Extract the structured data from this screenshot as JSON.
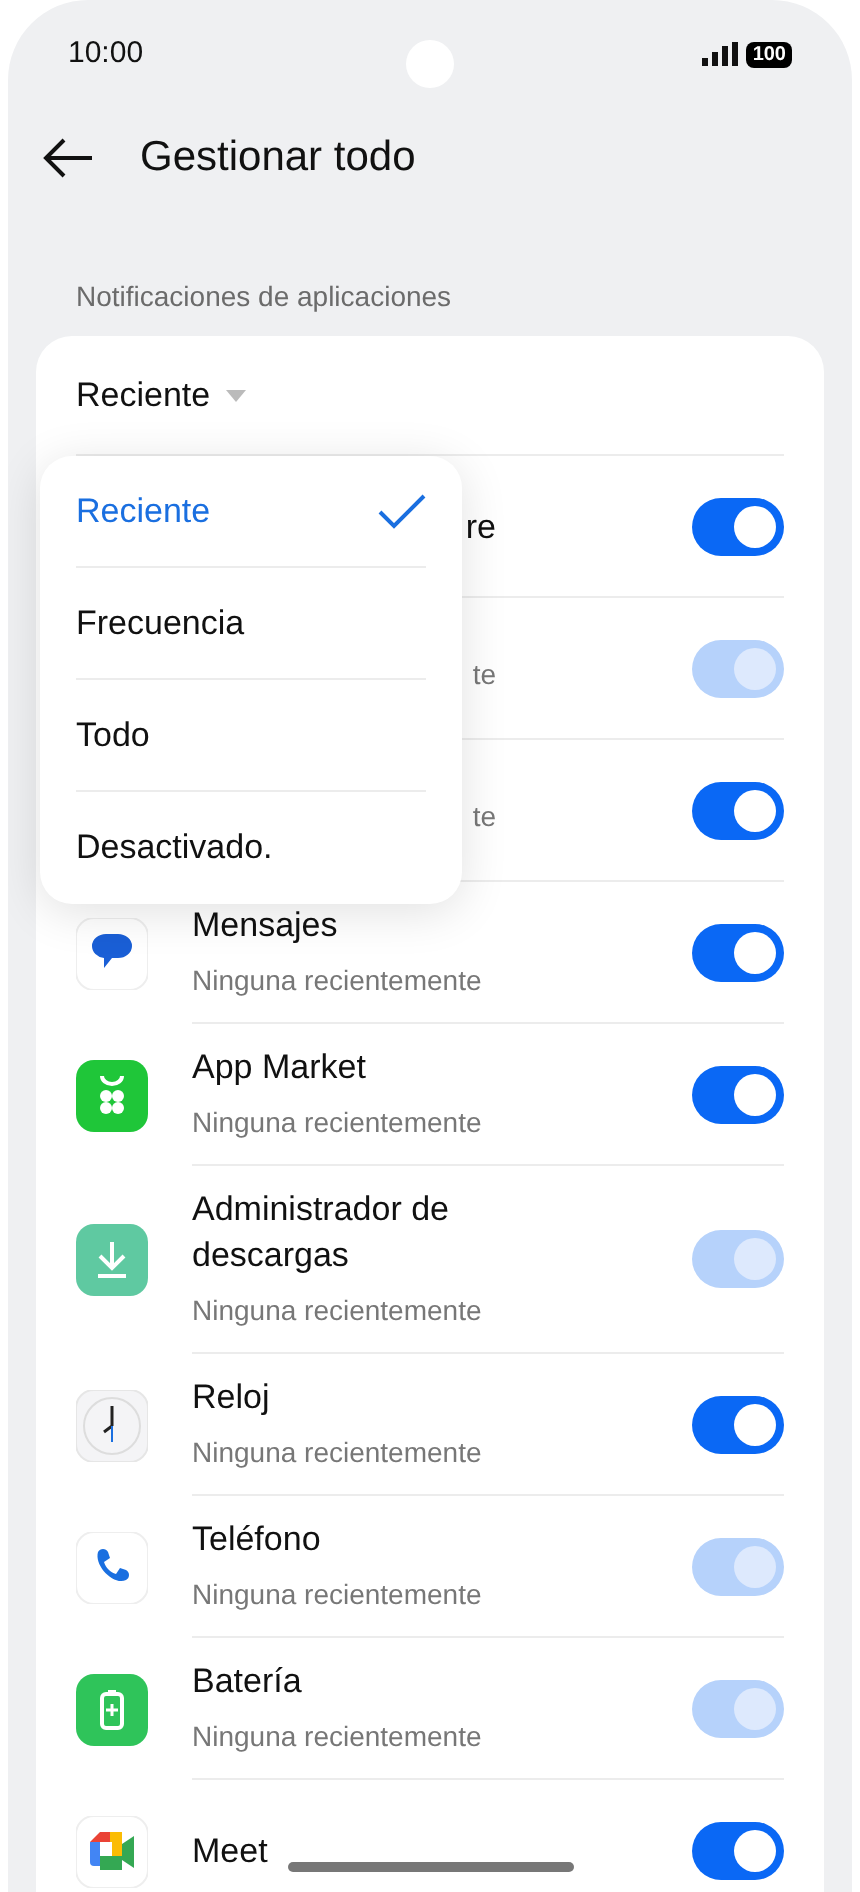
{
  "status_bar": {
    "time": "10:00",
    "battery": "100"
  },
  "header": {
    "title": "Gestionar todo"
  },
  "section_label": "Notificaciones de aplicaciones",
  "sort": {
    "label": "Reciente"
  },
  "menu": [
    {
      "label": "Reciente",
      "selected": true
    },
    {
      "label": "Frecuencia",
      "selected": false
    },
    {
      "label": "Todo",
      "selected": false
    },
    {
      "label": "Desactivado.",
      "selected": false
    }
  ],
  "apps": [
    {
      "covered": true,
      "title": "re",
      "on": true,
      "disabled": false
    },
    {
      "covered": true,
      "subtitle": "te",
      "on": true,
      "disabled": true
    },
    {
      "covered": true,
      "subtitle": "te",
      "on": true,
      "disabled": false
    },
    {
      "covered": false,
      "title": "Mensajes",
      "subtitle": "Ninguna recientemente",
      "on": true,
      "disabled": false
    },
    {
      "covered": false,
      "title": "App Market",
      "subtitle": "Ninguna recientemente",
      "on": true,
      "disabled": false
    },
    {
      "covered": false,
      "title": "Administrador de descargas",
      "subtitle": "Ninguna recientemente",
      "on": true,
      "disabled": true
    },
    {
      "covered": false,
      "title": "Reloj",
      "subtitle": "Ninguna recientemente",
      "on": true,
      "disabled": false
    },
    {
      "covered": false,
      "title": "Teléfono",
      "subtitle": "Ninguna recientemente",
      "on": true,
      "disabled": true
    },
    {
      "covered": false,
      "title": "Batería",
      "subtitle": "Ninguna recientemente",
      "on": true,
      "disabled": true
    },
    {
      "covered": false,
      "title": "Meet",
      "on": true,
      "disabled": false
    }
  ]
}
